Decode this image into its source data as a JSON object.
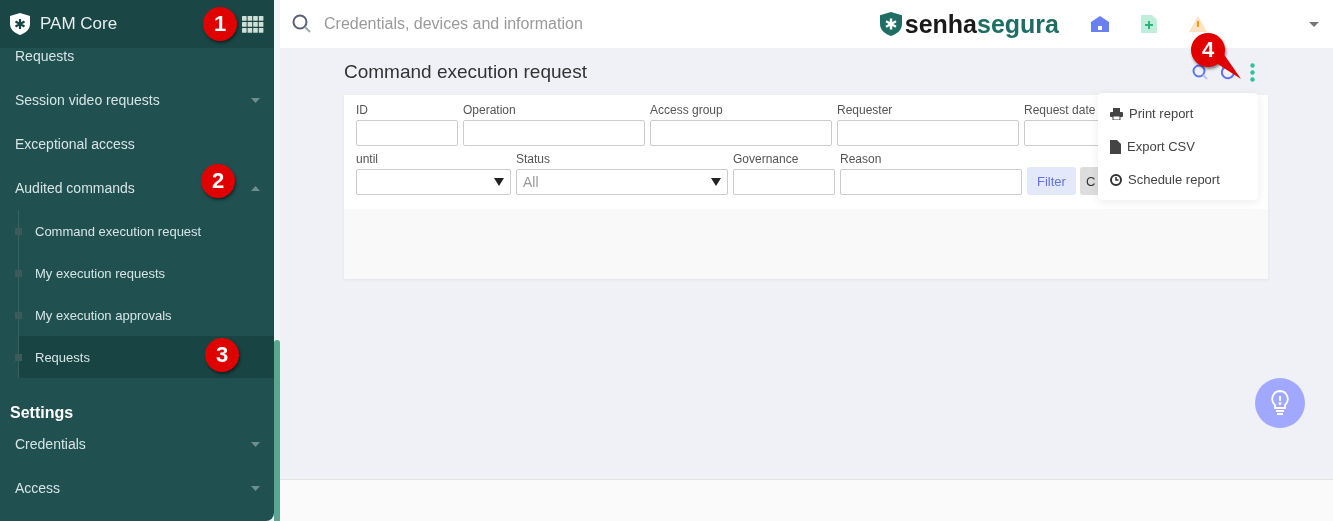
{
  "sidebar": {
    "app_title": "PAM Core",
    "items": [
      {
        "label": "Requests",
        "kind": "plain"
      },
      {
        "label": "Session video requests",
        "kind": "group",
        "expanded": false
      },
      {
        "label": "Exceptional access",
        "kind": "plain"
      },
      {
        "label": "Audited commands",
        "kind": "group",
        "expanded": true,
        "children": [
          {
            "label": "Command execution request",
            "selected": false
          },
          {
            "label": "My execution requests",
            "selected": false
          },
          {
            "label": "My execution approvals",
            "selected": false
          },
          {
            "label": "Requests",
            "selected": true
          }
        ]
      },
      {
        "label": "Settings",
        "kind": "heading"
      },
      {
        "label": "Credentials",
        "kind": "group",
        "expanded": false
      },
      {
        "label": "Access",
        "kind": "group",
        "expanded": false
      }
    ]
  },
  "topbar": {
    "search": {
      "placeholder": "Credentials, devices and information"
    },
    "brand": {
      "part_1": "senha",
      "part_2": "segura"
    }
  },
  "page": {
    "title": "Command execution request",
    "filters": [
      {
        "label": "ID",
        "kind": "input"
      },
      {
        "label": "Operation",
        "kind": "input"
      },
      {
        "label": "Access group",
        "kind": "input"
      },
      {
        "label": "Requester",
        "kind": "input"
      },
      {
        "label": "Request date",
        "kind": "input"
      },
      {
        "label": "until",
        "kind": "select"
      },
      {
        "label": "Status",
        "kind": "select",
        "value": "All"
      },
      {
        "label": "Governance",
        "kind": "input"
      },
      {
        "label": "Reason",
        "kind": "input"
      }
    ],
    "buttons": [
      {
        "label": "Filter",
        "kind": "primary"
      },
      {
        "label": "C",
        "kind": "secondary"
      }
    ],
    "menu": [
      {
        "label": "Print report",
        "kind": "print"
      },
      {
        "label": "Export CSV",
        "kind": "file"
      },
      {
        "label": "Schedule report",
        "kind": "clock"
      }
    ]
  },
  "callouts": [
    {
      "label": "1",
      "kind": "round"
    },
    {
      "label": "2",
      "kind": "round"
    },
    {
      "label": "3",
      "kind": "round"
    },
    {
      "label": "4",
      "kind": "pointer"
    }
  ]
}
